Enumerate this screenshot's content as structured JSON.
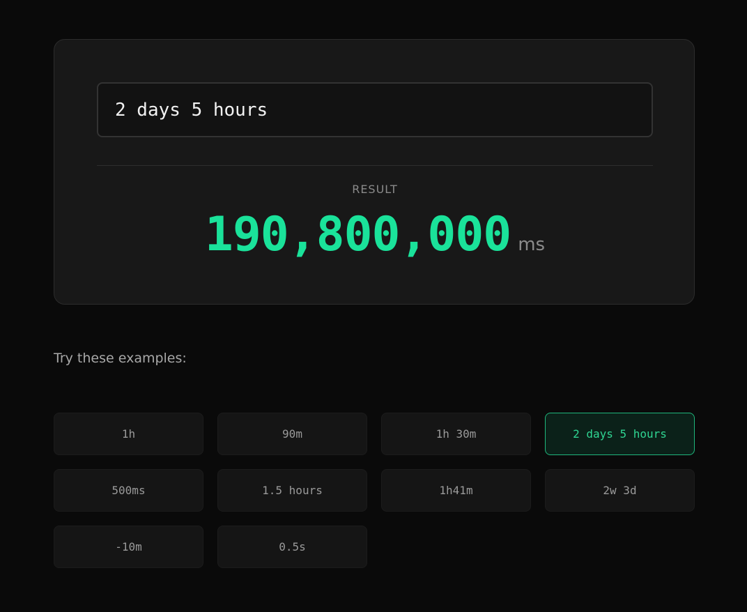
{
  "input": {
    "value": "2 days 5 hours"
  },
  "result": {
    "label": "RESULT",
    "value": "190,800,000",
    "unit": "ms"
  },
  "examples": {
    "heading": "Try these examples:",
    "items": [
      {
        "label": "1h",
        "active": false
      },
      {
        "label": "90m",
        "active": false
      },
      {
        "label": "1h 30m",
        "active": false
      },
      {
        "label": "2 days 5 hours",
        "active": true
      },
      {
        "label": "500ms",
        "active": false
      },
      {
        "label": "1.5 hours",
        "active": false
      },
      {
        "label": "1h41m",
        "active": false
      },
      {
        "label": "2w 3d",
        "active": false
      },
      {
        "label": "-10m",
        "active": false
      },
      {
        "label": "0.5s",
        "active": false
      }
    ]
  },
  "colors": {
    "accent": "#1ae29a",
    "background": "#0a0a0a",
    "card": "#181818"
  }
}
